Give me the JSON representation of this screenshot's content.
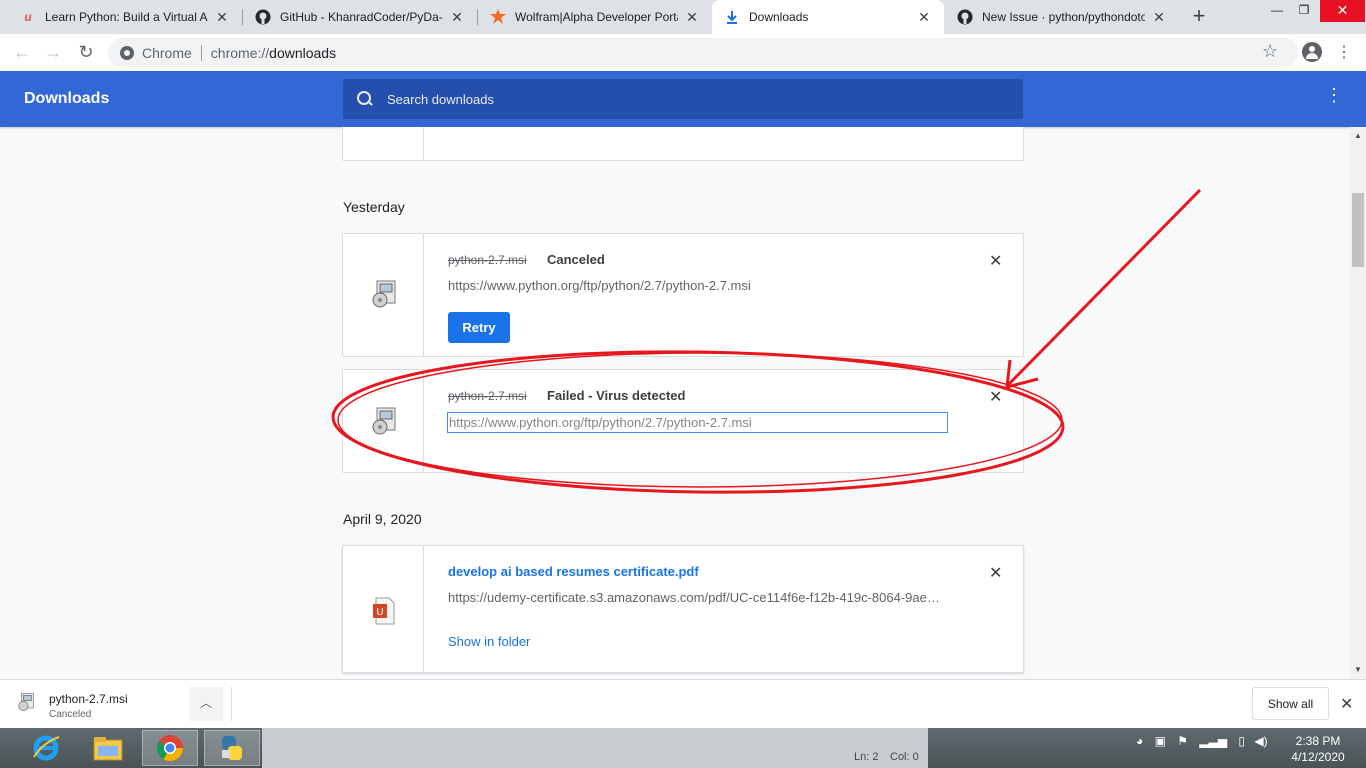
{
  "tabs": [
    {
      "title": "Learn Python: Build a Virtual Ass",
      "icon": "udemy-icon"
    },
    {
      "title": "GitHub - KhanradCoder/PyDa-C",
      "icon": "github-icon"
    },
    {
      "title": "Wolfram|Alpha Developer Porta",
      "icon": "wolfram-icon"
    },
    {
      "title": "Downloads",
      "icon": "download-icon",
      "active": true
    },
    {
      "title": "New Issue · python/pythondoto",
      "icon": "github-icon"
    }
  ],
  "omnibox": {
    "label": "Chrome",
    "scheme": "chrome://",
    "path": "downloads"
  },
  "header": {
    "title": "Downloads",
    "search_placeholder": "Search downloads"
  },
  "sections": [
    {
      "date": "Yesterday"
    },
    {
      "date": "April 9, 2020"
    }
  ],
  "downloads": [
    {
      "file": "python-2.7.msi",
      "status": "Canceled",
      "url": "https://www.python.org/ftp/python/2.7/python-2.7.msi",
      "action": "Retry"
    },
    {
      "file": "python-2.7.msi",
      "status": "Failed - Virus detected",
      "url": "https://www.python.org/ftp/python/2.7/python-2.7.msi"
    },
    {
      "file": "develop ai based resumes certificate.pdf",
      "url": "https://udemy-certificate.s3.amazonaws.com/pdf/UC-ce114f6e-f12b-419c-8064-9ae…",
      "action": "Show in folder"
    }
  ],
  "shelf": {
    "file": "python-2.7.msi",
    "status": "Canceled",
    "show_all": "Show all"
  },
  "taskbar": {
    "status_ln": "Ln: 2",
    "status_col": "Col: 0",
    "time": "2:38 PM",
    "date": "4/12/2020"
  },
  "colors": {
    "accent": "#3367d6",
    "link": "#1a73e8",
    "annotation": "#e8161d"
  }
}
